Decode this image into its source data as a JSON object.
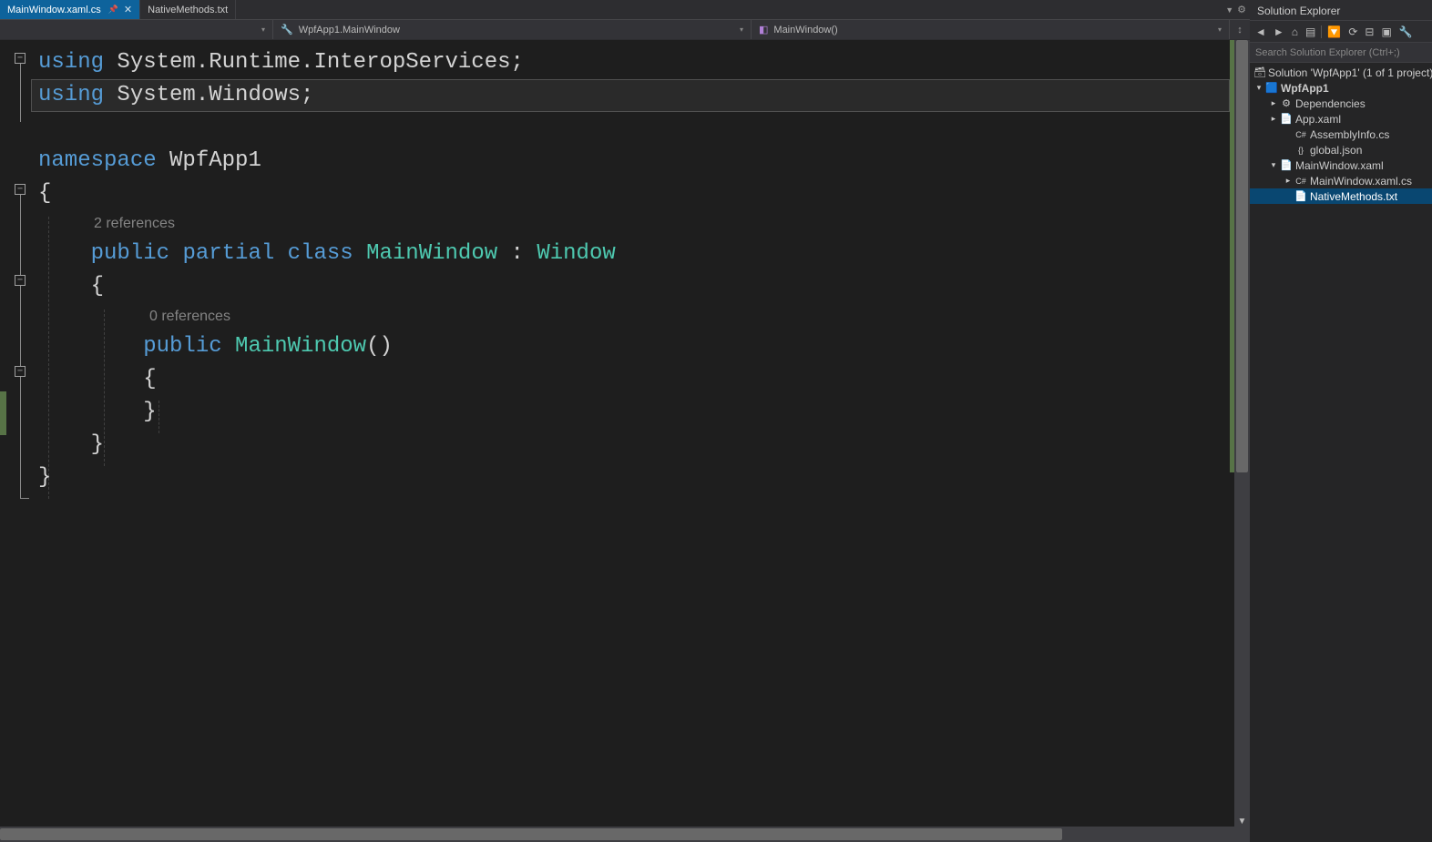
{
  "tabs": {
    "active": {
      "label": "MainWindow.xaml.cs"
    },
    "items": [
      {
        "label": "NativeMethods.txt"
      }
    ]
  },
  "navbar": {
    "left_label": "",
    "mid_label": "WpfApp1.MainWindow",
    "right_label": "MainWindow()"
  },
  "code": {
    "lines": [
      {
        "kind": "code",
        "tokens": [
          [
            "kw",
            "using"
          ],
          [
            "pln",
            " "
          ],
          [
            "pln",
            "System.Runtime.InteropServices;"
          ]
        ]
      },
      {
        "kind": "code",
        "current": true,
        "tokens": [
          [
            "kw",
            "using"
          ],
          [
            "pln",
            " "
          ],
          [
            "pln",
            "System.Windows;"
          ]
        ]
      },
      {
        "kind": "blank"
      },
      {
        "kind": "code",
        "tokens": [
          [
            "kw",
            "namespace"
          ],
          [
            "pln",
            " "
          ],
          [
            "pln",
            "WpfApp1"
          ]
        ]
      },
      {
        "kind": "code",
        "tokens": [
          [
            "pln",
            "{"
          ]
        ]
      },
      {
        "kind": "codelens",
        "indent": 1,
        "text": "2 references"
      },
      {
        "kind": "code",
        "indent": 1,
        "tokens": [
          [
            "kw",
            "public"
          ],
          [
            "pln",
            " "
          ],
          [
            "kw",
            "partial"
          ],
          [
            "pln",
            " "
          ],
          [
            "kw",
            "class"
          ],
          [
            "pln",
            " "
          ],
          [
            "cls",
            "MainWindow"
          ],
          [
            "pln",
            " : "
          ],
          [
            "typ",
            "Window"
          ]
        ]
      },
      {
        "kind": "code",
        "indent": 1,
        "tokens": [
          [
            "pln",
            "{"
          ]
        ]
      },
      {
        "kind": "codelens",
        "indent": 2,
        "text": "0 references"
      },
      {
        "kind": "code",
        "indent": 2,
        "tokens": [
          [
            "kw",
            "public"
          ],
          [
            "pln",
            " "
          ],
          [
            "cls",
            "MainWindow"
          ],
          [
            "pln",
            "()"
          ]
        ]
      },
      {
        "kind": "code",
        "indent": 2,
        "tokens": [
          [
            "pln",
            "{"
          ]
        ]
      },
      {
        "kind": "code",
        "indent": 2,
        "tokens": [
          [
            "pln",
            "}"
          ]
        ]
      },
      {
        "kind": "code",
        "indent": 1,
        "tokens": [
          [
            "pln",
            "}"
          ]
        ]
      },
      {
        "kind": "code",
        "tokens": [
          [
            "pln",
            "}"
          ]
        ]
      }
    ]
  },
  "solution_explorer": {
    "title": "Solution Explorer",
    "search_placeholder": "Search Solution Explorer (Ctrl+;)",
    "tree": [
      {
        "depth": 0,
        "exp": "",
        "ico": "sln",
        "label": "Solution 'WpfApp1' (1 of 1 project)"
      },
      {
        "depth": 0,
        "exp": "▾",
        "ico": "proj",
        "label": "WpfApp1",
        "bold": true
      },
      {
        "depth": 1,
        "exp": "▸",
        "ico": "dep",
        "label": "Dependencies"
      },
      {
        "depth": 1,
        "exp": "▸",
        "ico": "xaml",
        "label": "App.xaml"
      },
      {
        "depth": 2,
        "exp": "",
        "ico": "cs",
        "label": "AssemblyInfo.cs"
      },
      {
        "depth": 2,
        "exp": "",
        "ico": "json",
        "label": "global.json"
      },
      {
        "depth": 1,
        "exp": "▾",
        "ico": "xaml",
        "label": "MainWindow.xaml"
      },
      {
        "depth": 2,
        "exp": "▸",
        "ico": "cs",
        "label": "MainWindow.xaml.cs"
      },
      {
        "depth": 2,
        "exp": "",
        "ico": "txt",
        "label": "NativeMethods.txt",
        "selected": true
      }
    ]
  }
}
